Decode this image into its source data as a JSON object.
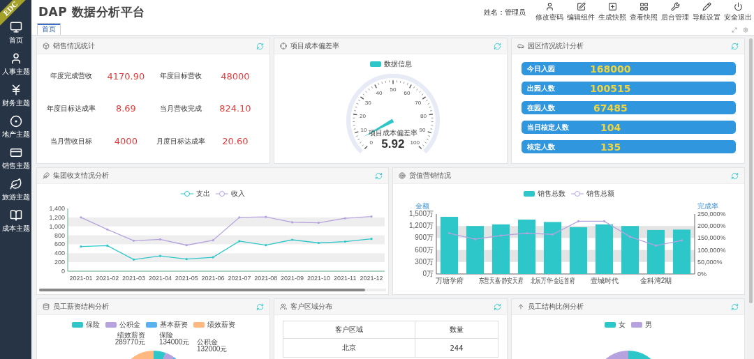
{
  "ribbon": "EDC",
  "title": "DAP 数据分析平台",
  "user": "姓名：管理员",
  "toolbar": [
    {
      "label": "修改密码"
    },
    {
      "label": "编辑组件"
    },
    {
      "label": "生成快照"
    },
    {
      "label": "查看快照"
    },
    {
      "label": "后台管理"
    },
    {
      "label": "导航设置"
    },
    {
      "label": "安全退出"
    }
  ],
  "tabs": [
    {
      "label": "首页",
      "selected": true
    }
  ],
  "sidebar": {
    "items": [
      {
        "label": "首页"
      },
      {
        "label": "人事主题"
      },
      {
        "label": "财务主题"
      },
      {
        "label": "地产主题"
      },
      {
        "label": "销售主题"
      },
      {
        "label": "旅游主题"
      },
      {
        "label": "成本主题"
      }
    ]
  },
  "sales_stats": {
    "title": "销售情况统计",
    "items": [
      {
        "label": "年度完成营收",
        "value": "4170.90"
      },
      {
        "label": "年度目标营收",
        "value": "48000"
      },
      {
        "label": "年度目标达成率",
        "value": "8.69"
      },
      {
        "label": "当月营收完成",
        "value": "824.10"
      },
      {
        "label": "当月营收目标",
        "value": "4000"
      },
      {
        "label": "月度目标达成率",
        "value": "20.60"
      }
    ]
  },
  "cost_gauge": {
    "title": "项目成本偏差率",
    "legend": "数据信息",
    "gauge_title": "项目成本偏差率",
    "value": "5.92",
    "ticks": [
      "0",
      "10",
      "20",
      "30",
      "40",
      "50",
      "60",
      "70",
      "80",
      "90",
      "100"
    ]
  },
  "park_stats": {
    "title": "园区情况统计分析",
    "items": [
      {
        "label": "今日入园",
        "value": "168000"
      },
      {
        "label": "出园人数",
        "value": "100515"
      },
      {
        "label": "在园人数",
        "value": "67485"
      },
      {
        "label": "当日核定人数",
        "value": "104"
      },
      {
        "label": "核定人数",
        "value": "135"
      }
    ]
  },
  "income_chart": {
    "title": "集团收支情况分析",
    "chart_data": {
      "type": "line",
      "categories": [
        "2021-01",
        "2021-02",
        "2021-03",
        "2021-04",
        "2021-05",
        "2021-06",
        "2021-07",
        "2021-08",
        "2021-09",
        "2021-10",
        "2021-11",
        "2021-12"
      ],
      "series": [
        {
          "name": "支出",
          "color": "#2ec7c9",
          "values": [
            550,
            570,
            260,
            340,
            270,
            310,
            670,
            580,
            700,
            630,
            660,
            720
          ]
        },
        {
          "name": "收入",
          "color": "#b6a2de",
          "values": [
            1200,
            930,
            680,
            710,
            580,
            690,
            1200,
            1210,
            1090,
            1080,
            1180,
            1220
          ]
        }
      ],
      "ylim": [
        0,
        1400
      ],
      "yticks": [
        0,
        200,
        400,
        600,
        800,
        {
          "value": 1000,
          "label": "1,000"
        },
        {
          "value": 1200,
          "label": "1,200"
        },
        {
          "value": 1400,
          "label": "1,400"
        }
      ]
    }
  },
  "sales_chart": {
    "title": "货值营销情况",
    "chart_data": {
      "type": "bar",
      "categories": [
        "万塘学府",
        null,
        "东营天嘉·静安天府",
        null,
        "北辰万华·金运首府",
        null,
        "壹城时代",
        null,
        "金科湾2期",
        null
      ],
      "ylabel": "金额",
      "series": [
        {
          "name": "销售总数",
          "color": "#2ec7c9",
          "values": [
            1430,
            1200,
            1240,
            1360,
            1300,
            1170,
            1240,
            1200,
            1100,
            1110
          ]
        }
      ],
      "ylim": [
        0,
        1500
      ],
      "yticks": [
        {
          "value": 0,
          "label": "0万"
        },
        {
          "value": 300,
          "label": "300万"
        },
        {
          "value": 600,
          "label": "600万"
        },
        {
          "value": 900,
          "label": "900万"
        },
        {
          "value": 1200,
          "label": "1,200万"
        },
        {
          "value": 1500,
          "label": "1,500万"
        }
      ]
    },
    "rate_chart": {
      "chart_data": {
        "type": "line",
        "ylabel": "完成率",
        "series": [
          {
            "name": "销售总额",
            "color": "#b6a2de",
            "values": [
              170000,
              145000,
              160000,
              170000,
              165000,
              220000,
              220000,
              155000,
              118000,
              140000
            ]
          }
        ],
        "ylim": [
          0,
          250000
        ],
        "yticks": [
          {
            "value": 0,
            "label": "0%"
          },
          {
            "value": 50000,
            "label": "50,000%"
          },
          {
            "value": 100000,
            "label": "100,000%"
          },
          {
            "value": 150000,
            "label": "150,000%"
          },
          {
            "value": 200000,
            "label": "200,000%"
          },
          {
            "value": 250000,
            "label": "250,000%"
          }
        ]
      }
    }
  },
  "salary_chart": {
    "title": "员工薪资结构分析",
    "legend": [
      {
        "label": "保险",
        "color": "#2ec7c9"
      },
      {
        "label": "公积金",
        "color": "#b6a2de"
      },
      {
        "label": "基本薪资",
        "color": "#5ab1ef"
      },
      {
        "label": "绩效薪资",
        "color": "#ffb980"
      }
    ],
    "slice_labels": [
      {
        "name": "绩效薪资",
        "value": "289770元"
      },
      {
        "name": "保险",
        "value": "134000元"
      },
      {
        "name": "公积金",
        "value": "132000元"
      }
    ]
  },
  "customer_table": {
    "title": "客户区域分布",
    "columns": [
      "客户区域",
      "数量"
    ],
    "rows": [
      [
        "北京",
        "244"
      ]
    ]
  },
  "staff_chart": {
    "title": "员工结构比例分析",
    "legend": [
      {
        "label": "女",
        "color": "#2ec7c9"
      },
      {
        "label": "男",
        "color": "#b6a2de"
      }
    ]
  }
}
